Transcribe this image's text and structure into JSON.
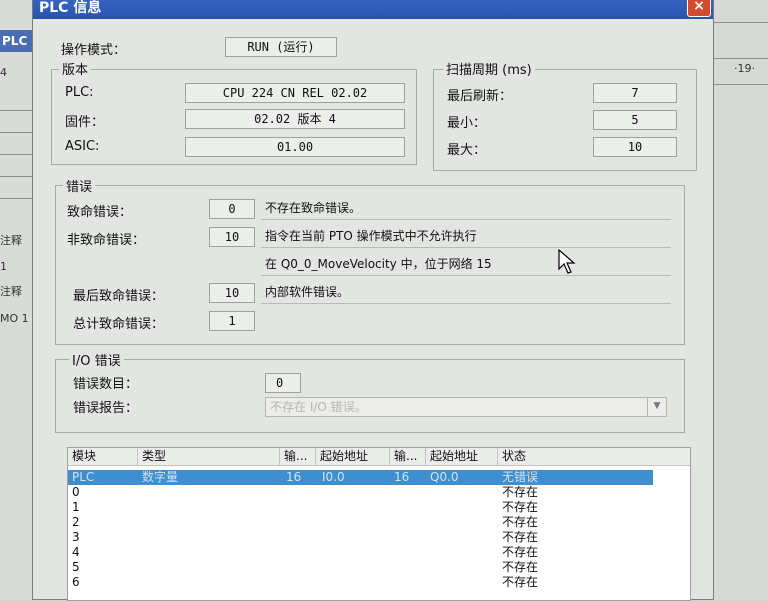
{
  "background": {
    "left_label": "PLC",
    "left_num": "4",
    "left_texts": [
      "注释",
      "1",
      "注释",
      "MO 1"
    ],
    "right_label": "·19·"
  },
  "window": {
    "title": "PLC 信息",
    "close": "×"
  },
  "mode": {
    "label": "操作模式：",
    "value": "RUN (运行)"
  },
  "version": {
    "title": "版本",
    "rows": [
      {
        "label": "PLC:",
        "value": "CPU 224 CN REL 02.02"
      },
      {
        "label": "固件：",
        "value": "02.02 版本 4"
      },
      {
        "label": "ASIC:",
        "value": "01.00"
      }
    ]
  },
  "scan": {
    "title": "扫描周期 (ms)",
    "rows": [
      {
        "label": "最后刷新：",
        "value": "7"
      },
      {
        "label": "最小：",
        "value": "5"
      },
      {
        "label": "最大：",
        "value": "10"
      }
    ]
  },
  "errors": {
    "title": "错误",
    "fatal": {
      "label": "致命错误：",
      "value": "0",
      "msg": "不存在致命错误。"
    },
    "nonfatal": {
      "label": "非致命错误：",
      "value": "10",
      "msg": "指令在当前 PTO 操作模式中不允许执行",
      "msg2": "在 Q0_0_MoveVelocity 中，位于网络 15"
    },
    "last_fatal": {
      "label": "最后致命错误：",
      "value": "10",
      "msg": "内部软件错误。"
    },
    "total_fatal": {
      "label": "总计致命错误：",
      "value": "1"
    }
  },
  "io": {
    "title": "I/O 错误",
    "count_label": "错误数目：",
    "count_value": "0",
    "report_label": "错误报告：",
    "report_value": "不存在 I/O 错误。"
  },
  "table": {
    "headers": [
      "模块",
      "类型",
      "输...",
      "起始地址",
      "输...",
      "起始地址",
      "状态"
    ],
    "rows": [
      {
        "module": "PLC",
        "type": "数字量",
        "in": "16",
        "in_addr": "I0.0",
        "out": "16",
        "out_addr": "Q0.0",
        "status": "无错误"
      },
      {
        "module": "0",
        "type": "",
        "in": "",
        "in_addr": "",
        "out": "",
        "out_addr": "",
        "status": "不存在"
      },
      {
        "module": "1",
        "type": "",
        "in": "",
        "in_addr": "",
        "out": "",
        "out_addr": "",
        "status": "不存在"
      },
      {
        "module": "2",
        "type": "",
        "in": "",
        "in_addr": "",
        "out": "",
        "out_addr": "",
        "status": "不存在"
      },
      {
        "module": "3",
        "type": "",
        "in": "",
        "in_addr": "",
        "out": "",
        "out_addr": "",
        "status": "不存在"
      },
      {
        "module": "4",
        "type": "",
        "in": "",
        "in_addr": "",
        "out": "",
        "out_addr": "",
        "status": "不存在"
      },
      {
        "module": "5",
        "type": "",
        "in": "",
        "in_addr": "",
        "out": "",
        "out_addr": "",
        "status": "不存在"
      },
      {
        "module": "6",
        "type": "",
        "in": "",
        "in_addr": "",
        "out": "",
        "out_addr": "",
        "status": "不存在"
      }
    ]
  }
}
